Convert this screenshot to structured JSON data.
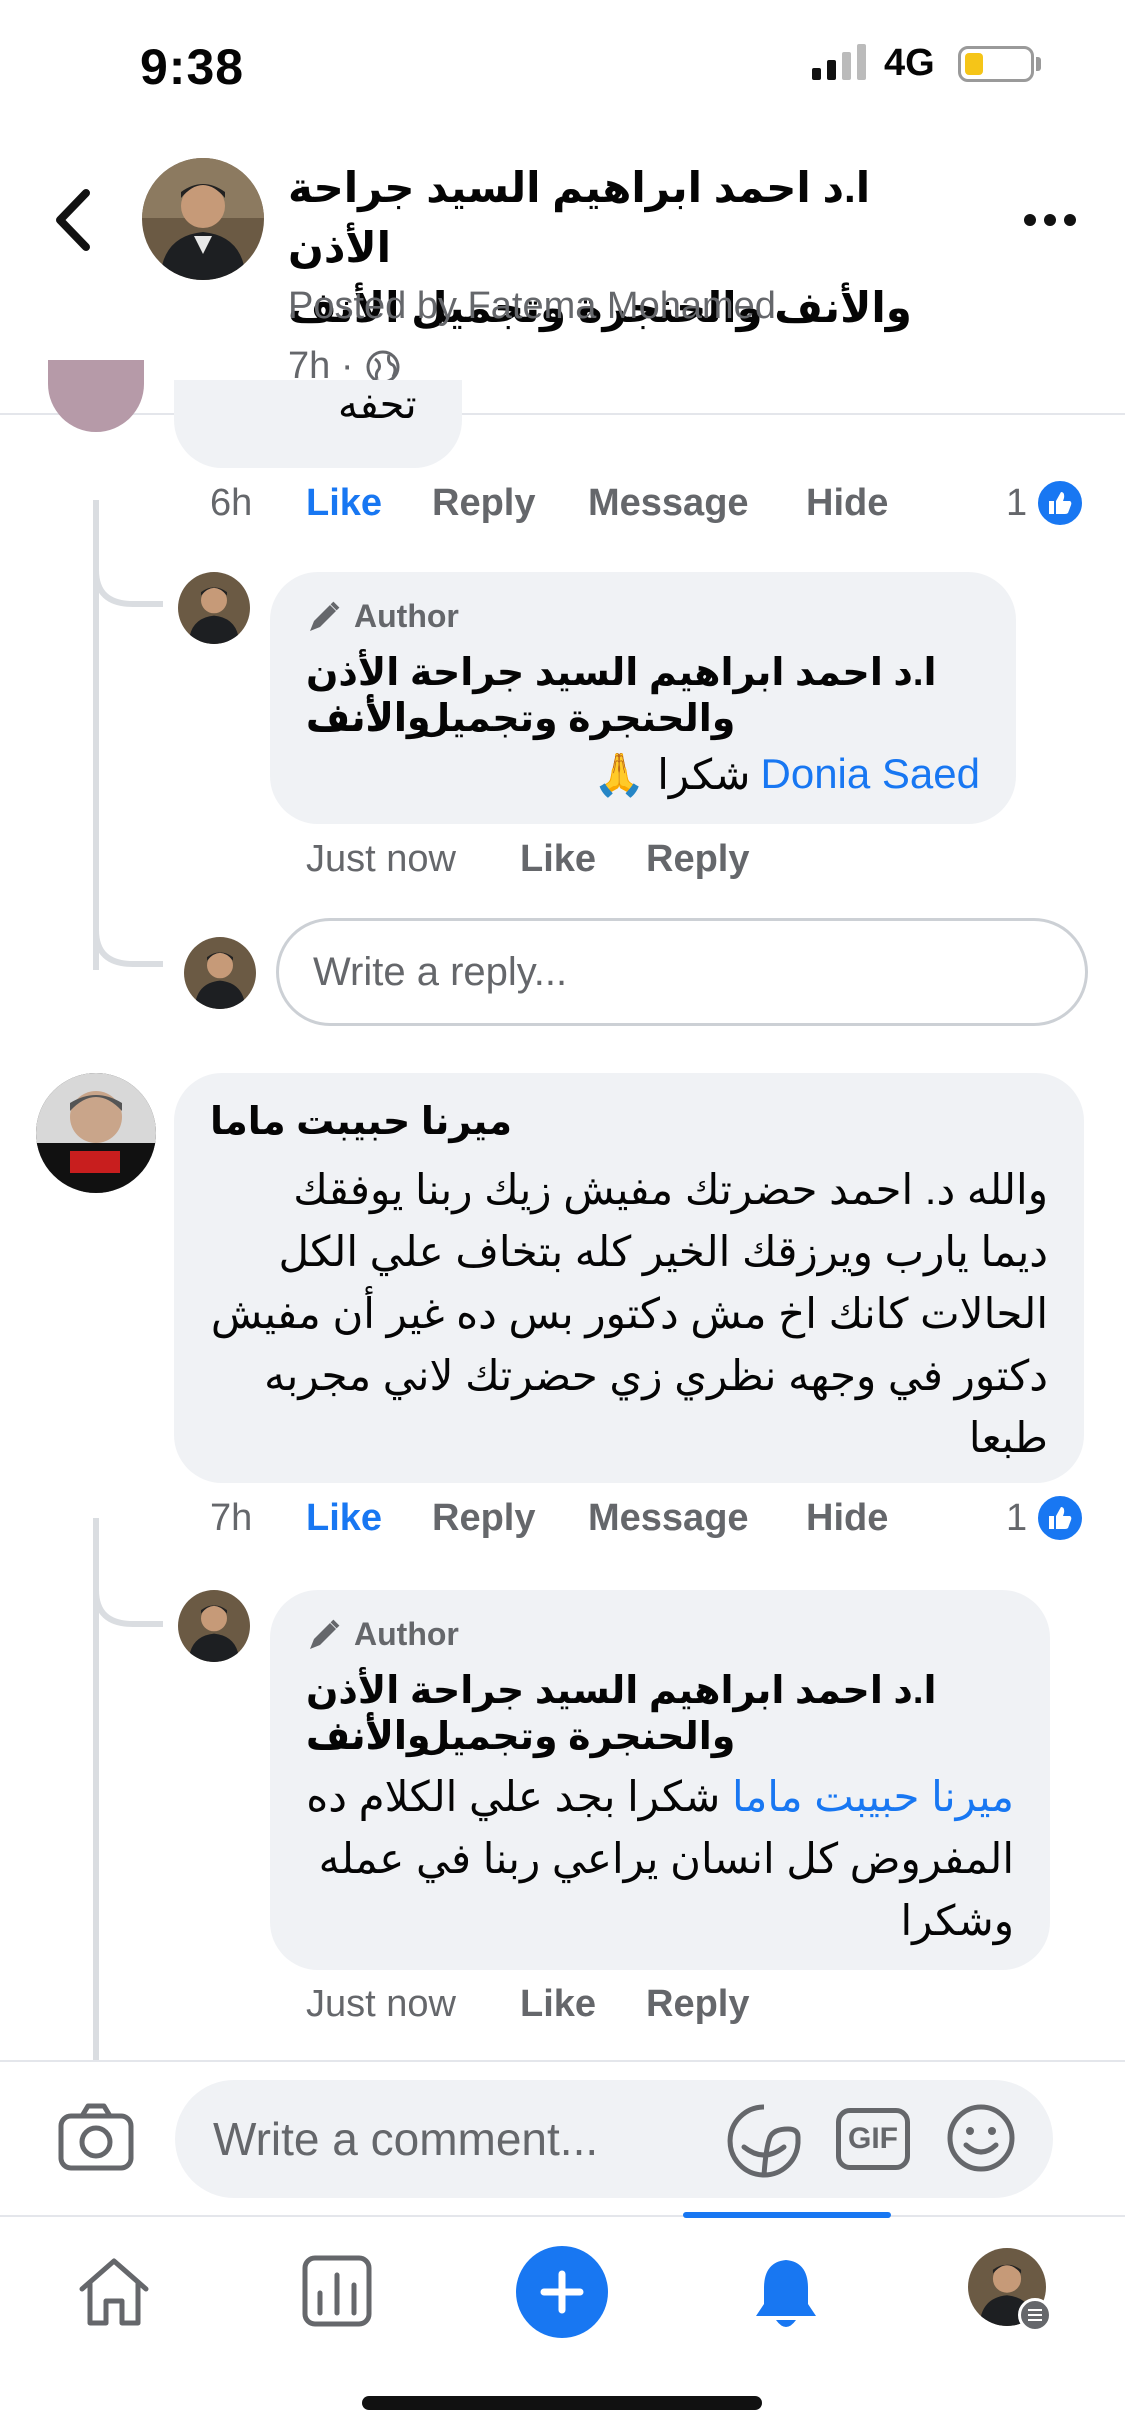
{
  "status": {
    "time": "9:38",
    "network": "4G"
  },
  "header": {
    "title_line1": "ا.د احمد ابراهيم السيد جراحة الأذن",
    "title_line2": "والأنف والحنجرة وتجميل الأنف",
    "posted_by": "Posted by Fatema Mohamed",
    "time": "7h ·"
  },
  "partial_comment": {
    "text_fragment": "تحفه",
    "time": "6h",
    "like": "Like",
    "reply": "Reply",
    "message": "Message",
    "hide": "Hide",
    "like_count": "1"
  },
  "author_reply_1": {
    "tag": "Author",
    "name_line1": "ا.د احمد ابراهيم السيد جراحة الأذن والأنف",
    "name_line2": "والحنجرة وتجميل الأنف",
    "mention": "Donia Saed",
    "text": "شكرا 🙏",
    "time": "Just now",
    "like": "Like",
    "reply": "Reply"
  },
  "reply_input": {
    "placeholder": "Write a reply..."
  },
  "comment_2": {
    "name": "ميرنا حبيبت ماما",
    "lines": [
      "والله د. احمد حضرتك مفيش زيك ربنا يوفقك",
      "ديما يارب ويرزقك الخير كله بتخاف علي الكل",
      "الحالات كانك اخ مش دكتور بس ده غير أن مفيش",
      "دكتور في وجهه نظري زي حضرتك لاني مجربه",
      "طبعا"
    ],
    "time": "7h",
    "like": "Like",
    "reply": "Reply",
    "message": "Message",
    "hide": "Hide",
    "like_count": "1"
  },
  "author_reply_2": {
    "tag": "Author",
    "name_line1": "ا.د احمد ابراهيم السيد جراحة الأذن والأنف",
    "name_line2": "والحنجرة وتجميل الأنف",
    "mention": "ميرنا حبيبت ماما",
    "line1_rest": " شكرا بجد علي الكلام ده",
    "line2": "المفروض كل انسان يراعي ربنا في عمله",
    "line3": "وشكرا",
    "time": "Just now",
    "like": "Like",
    "reply": "Reply"
  },
  "comment_bar": {
    "placeholder": "Write a comment...",
    "gif": "GIF"
  },
  "tabs": [
    "home-icon",
    "feed-icon",
    "create-icon",
    "notifications-icon",
    "profile-icon"
  ],
  "colors": {
    "accent": "#1877f2",
    "bubble": "#f0f2f5",
    "muted": "#65676b"
  }
}
